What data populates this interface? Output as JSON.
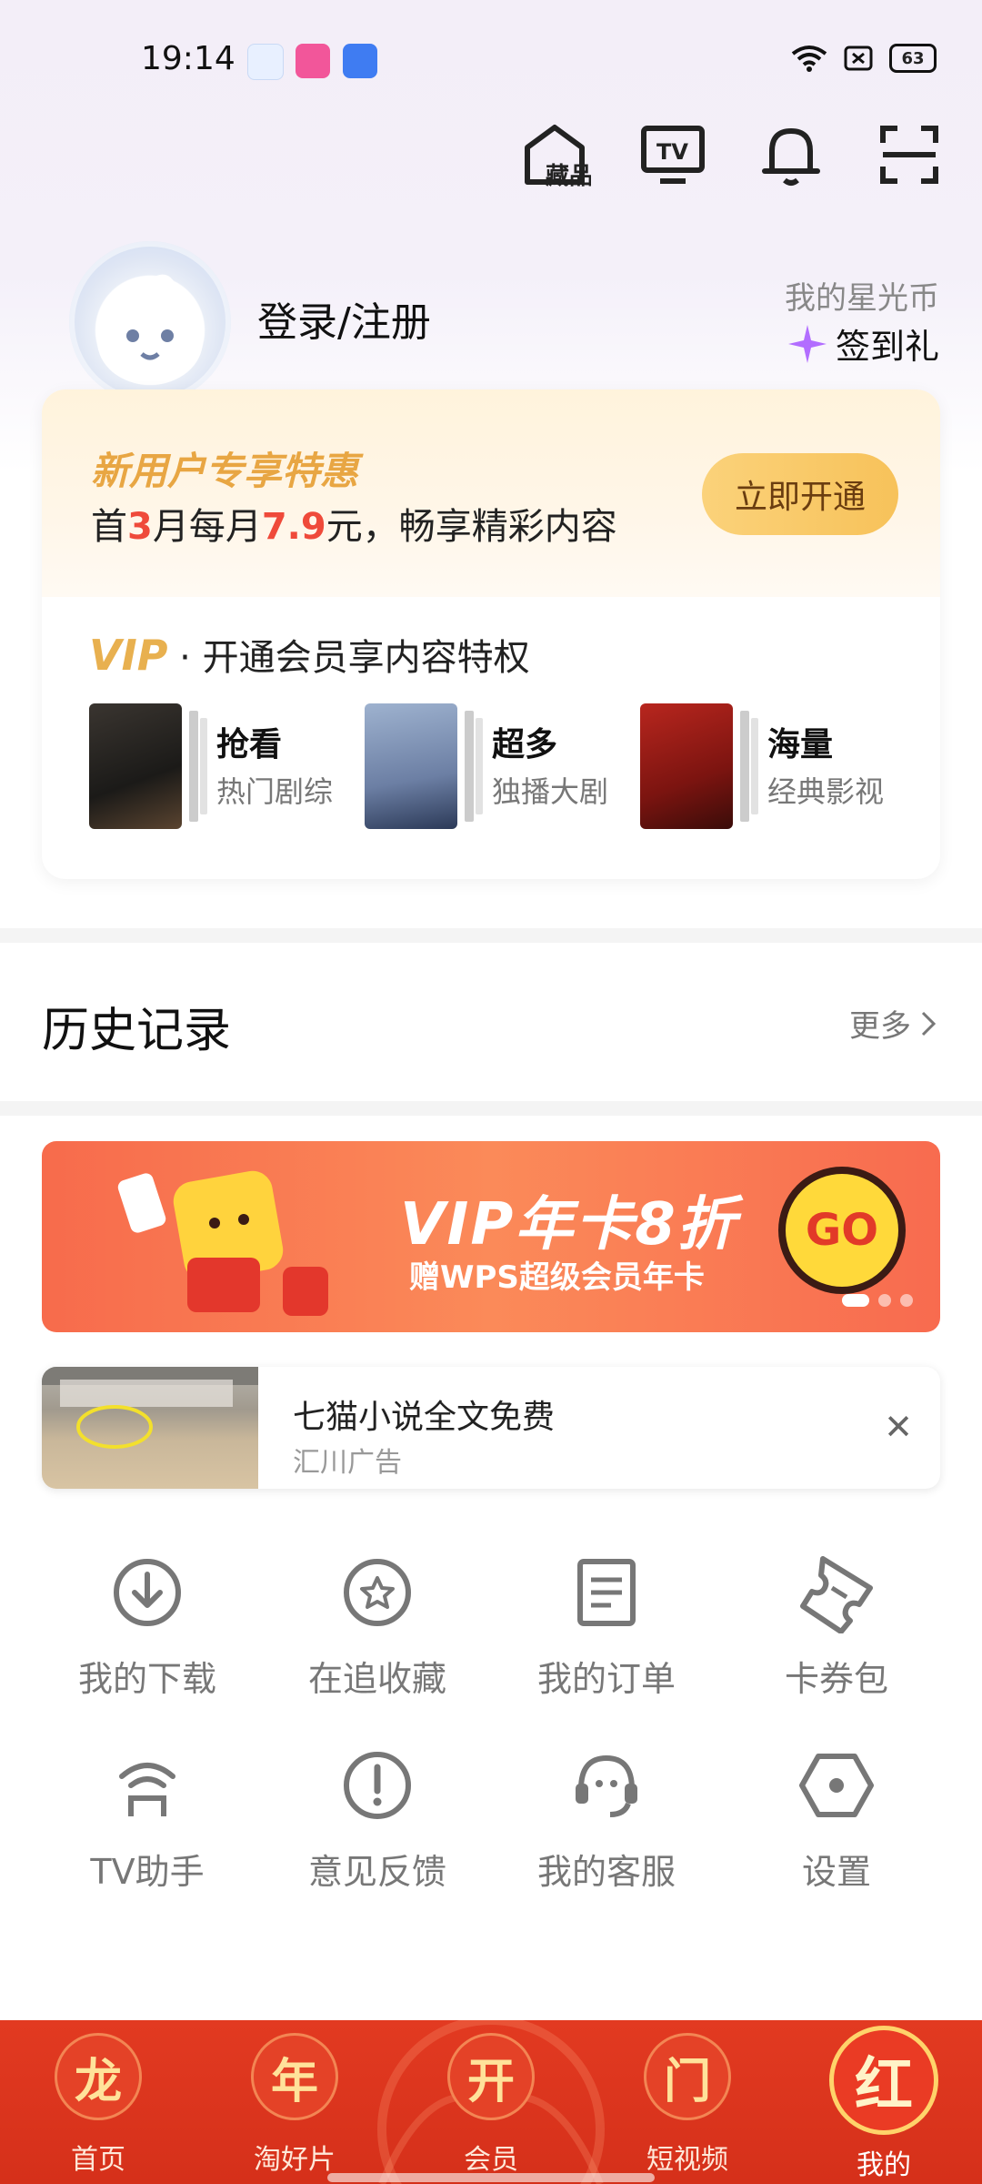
{
  "status_bar": {
    "time": "19:14",
    "battery": "63",
    "icons": [
      "app-1-icon",
      "bilibili-icon",
      "infinity-app-icon",
      "wifi-icon",
      "sim-x-icon",
      "battery-icon"
    ]
  },
  "top_icons": [
    "collection-icon",
    "tv-icon",
    "bell-icon",
    "scan-icon"
  ],
  "collection_label": "藏品",
  "tv_label": "TV",
  "profile": {
    "login_label": "登录/注册",
    "star_coin_label": "我的星光币",
    "checkin_label": "签到礼"
  },
  "vip_card": {
    "promo_title": "新用户专享特惠",
    "promo_sub_1": "首",
    "promo_sub_hl1": "3",
    "promo_sub_2": "月每月",
    "promo_sub_hl2": "7.9",
    "promo_sub_3": "元，畅享精彩内容",
    "open_button": "立即开通",
    "vip_word": "VIP",
    "vip_text": " · 开通会员享内容特权",
    "features": [
      {
        "title": "抢看",
        "sub": "热门剧综"
      },
      {
        "title": "超多",
        "sub": "独播大剧"
      },
      {
        "title": "海量",
        "sub": "经典影视"
      }
    ]
  },
  "history": {
    "title": "历史记录",
    "more": "更多"
  },
  "banner": {
    "line1": "VIP年卡8折",
    "line2": "赠WPS超级会员年卡",
    "go": "GO"
  },
  "ad": {
    "title": "七猫小说全文免费",
    "source": "汇川广告",
    "close": "✕"
  },
  "tools": [
    {
      "label": "我的下载",
      "icon": "download-icon"
    },
    {
      "label": "在追收藏",
      "icon": "star-icon"
    },
    {
      "label": "我的订单",
      "icon": "order-icon"
    },
    {
      "label": "卡券包",
      "icon": "ticket-icon"
    },
    {
      "label": "TV助手",
      "icon": "tv-assistant-icon"
    },
    {
      "label": "意见反馈",
      "icon": "feedback-icon"
    },
    {
      "label": "我的客服",
      "icon": "customer-service-icon"
    },
    {
      "label": "设置",
      "icon": "settings-icon"
    }
  ],
  "bottom_nav": [
    {
      "glyph": "龙",
      "label": "首页"
    },
    {
      "glyph": "年",
      "label": "淘好片"
    },
    {
      "glyph": "开",
      "label": "会员"
    },
    {
      "glyph": "门",
      "label": "短视频"
    },
    {
      "glyph": "红",
      "label": "我的"
    }
  ],
  "colors": {
    "accent_gold": "#e8a643",
    "price_red": "#ef4a3a",
    "nav_red": "#d5301a"
  }
}
